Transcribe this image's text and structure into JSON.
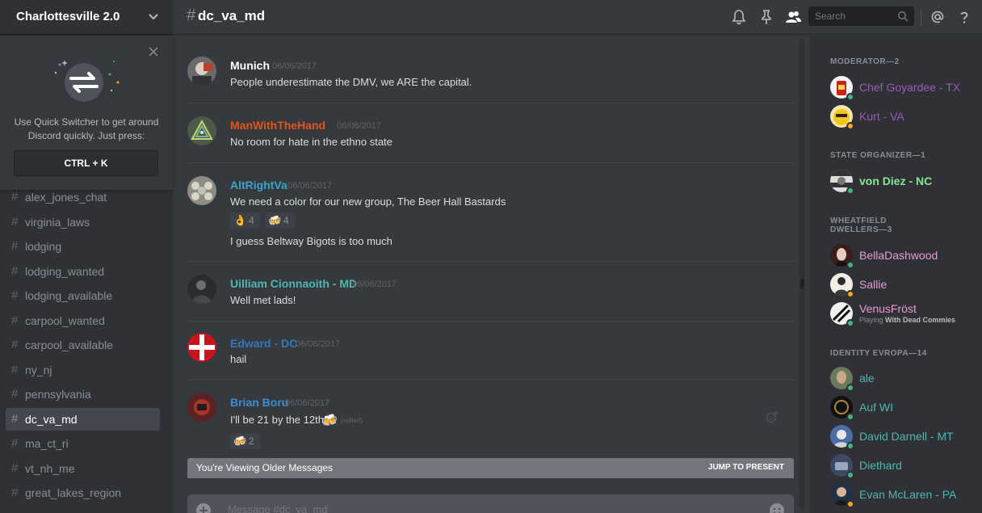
{
  "server": {
    "name": "Charlottesville 2.0"
  },
  "quick_switcher": {
    "description": "Use Quick Switcher to get around Discord quickly. Just press:",
    "shortcut": "CTRL + K"
  },
  "channels": [
    {
      "name": "alex_jones_chat"
    },
    {
      "name": "virginia_laws"
    },
    {
      "name": "lodging"
    },
    {
      "name": "lodging_wanted"
    },
    {
      "name": "lodging_available"
    },
    {
      "name": "carpool_wanted"
    },
    {
      "name": "carpool_available"
    },
    {
      "name": "ny_nj"
    },
    {
      "name": "pennsylvania"
    },
    {
      "name": "dc_va_md",
      "active": true
    },
    {
      "name": "ma_ct_ri"
    },
    {
      "name": "vt_nh_me"
    },
    {
      "name": "great_lakes_region"
    }
  ],
  "topbar": {
    "hash": "#",
    "channel_name": "dc_va_md",
    "search_placeholder": "Search"
  },
  "messages": [
    {
      "author": "Munich",
      "author_color": "#ffffff",
      "timestamp": "06/06/2017",
      "lines": [
        "People underestimate the DMV, we ARE the capital."
      ]
    },
    {
      "author": "ManWithTheHand",
      "author_color": "#e2541b",
      "timestamp": "06/06/2017",
      "lines": [
        "No room for hate in the ethno state"
      ]
    },
    {
      "author": "AltRightVa",
      "author_color": "#3aa5c9",
      "timestamp": "06/06/2017",
      "lines": [
        "We need a color for our new group, The Beer Hall Bastards",
        "I guess Beltway Bigots is too much"
      ],
      "reactions": [
        {
          "emoji": "👌",
          "count": "4"
        },
        {
          "emoji": "🍻",
          "count": "4"
        }
      ]
    },
    {
      "author": "Uilliam Cionnaoith - MD",
      "author_color": "#4fb6b0",
      "timestamp": "06/06/2017",
      "lines": [
        "Well met lads!"
      ]
    },
    {
      "author": "Edward - DC",
      "author_color": "#3577b8",
      "timestamp": "06/06/2017",
      "lines": [
        "hail"
      ]
    },
    {
      "author": "Brian Boru",
      "author_color": "#3c8ed1",
      "timestamp": "06/06/2017",
      "lines": [
        "I'll be 21 by the 12th"
      ],
      "edited": "(edited)",
      "reactions": [
        {
          "emoji": "🍻",
          "count": "2"
        }
      ]
    }
  ],
  "older_bar": {
    "text": "You're Viewing Older Messages",
    "jump": "JUMP TO PRESENT"
  },
  "composer": {
    "placeholder": "Message #dc_va_md"
  },
  "member_groups": [
    {
      "role": "MODERATOR—2",
      "members": [
        {
          "name": "Chef Goyardee - TX",
          "color": "#9b59b6",
          "status": "#43b581"
        },
        {
          "name": "Kurt - VA",
          "color": "#9b59b6",
          "status": "#faa61a"
        }
      ]
    },
    {
      "role": "STATE ORGANIZER—1",
      "members": [
        {
          "name": "von Diez - NC",
          "color": "#8ae691",
          "status": "#43b581"
        }
      ]
    },
    {
      "role": "WHEATFIELD DWELLERS—3",
      "members": [
        {
          "name": "BellaDashwood",
          "color": "#e79bd2",
          "status": "#43b581"
        },
        {
          "name": "Sallie",
          "color": "#e79bd2",
          "status": "#faa61a"
        },
        {
          "name": "VenusFröst",
          "color": "#e79bd2",
          "status": "#43b581",
          "activity_prefix": "Playing",
          "activity": "With Dead Commies"
        }
      ]
    },
    {
      "role": "IDENTITY EVROPA—14",
      "members": [
        {
          "name": "ale",
          "color": "#4fb6b0",
          "status": "#43b581"
        },
        {
          "name": "Auf WI",
          "color": "#4fb6b0",
          "status": "#43b581"
        },
        {
          "name": "David Darnell - MT",
          "color": "#4fb6b0",
          "status": "#43b581"
        },
        {
          "name": "Diethard",
          "color": "#4fb6b0",
          "status": "#43b581"
        },
        {
          "name": "Evan McLaren - PA",
          "color": "#4fb6b0",
          "status": "#faa61a"
        }
      ]
    }
  ]
}
